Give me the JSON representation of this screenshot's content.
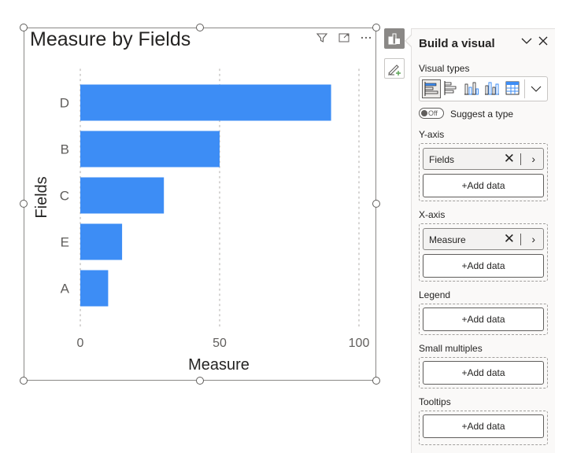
{
  "chart_data": {
    "type": "bar",
    "orientation": "horizontal",
    "title": "Measure by Fields",
    "categories": [
      "D",
      "B",
      "C",
      "E",
      "A"
    ],
    "values": [
      90,
      50,
      30,
      15,
      10
    ],
    "xlabel": "Measure",
    "ylabel": "Fields",
    "xlim": [
      0,
      100
    ],
    "xticks": [
      "0",
      "50",
      "100"
    ],
    "grid": "vertical dotted",
    "bar_color": "#3D8DF5"
  },
  "visual_header": {
    "icons": [
      "filter-icon",
      "focus-mode-icon",
      "more-options-icon"
    ]
  },
  "toolbar": {
    "buttons": [
      "build-visual-icon",
      "format-visual-icon"
    ]
  },
  "pane": {
    "title": "Build a visual",
    "visual_types_label": "Visual types",
    "suggest_label": "Suggest a type",
    "toggle_state": "Off",
    "sections": {
      "y_axis": {
        "label": "Y-axis",
        "field": "Fields",
        "add_label": "+Add data"
      },
      "x_axis": {
        "label": "X-axis",
        "field": "Measure",
        "add_label": "+Add data"
      },
      "legend": {
        "label": "Legend",
        "add_label": "+Add data"
      },
      "small_multiples": {
        "label": "Small multiples",
        "add_label": "+Add data"
      },
      "tooltips": {
        "label": "Tooltips",
        "add_label": "+Add data"
      }
    }
  }
}
